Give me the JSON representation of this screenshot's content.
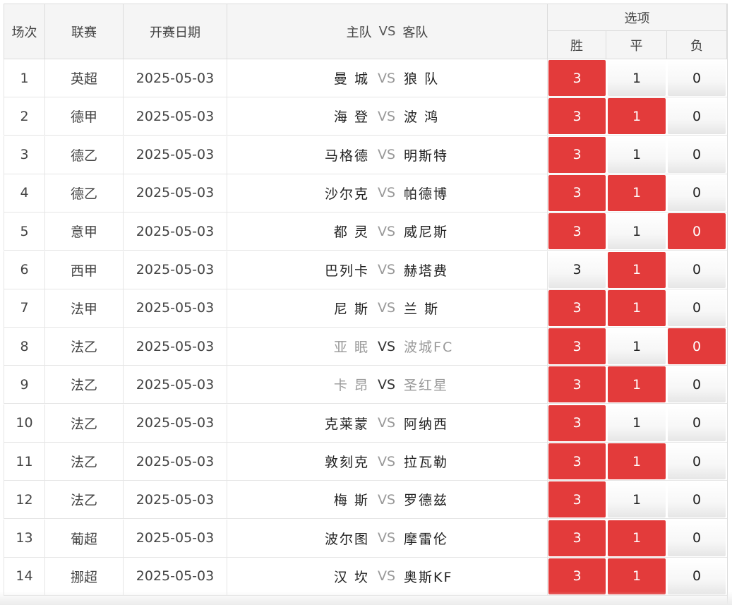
{
  "header": {
    "col_index": "场次",
    "col_league": "联赛",
    "col_date": "开赛日期",
    "col_home": "主队",
    "col_vs": "VS",
    "col_away": "客队",
    "col_options": "选项",
    "opt_win": "胜",
    "opt_draw": "平",
    "opt_loss": "负"
  },
  "colors": {
    "selected": "#e33b3b",
    "selected_text": "#ffffff",
    "vs_gray": "#999999"
  },
  "rows": [
    {
      "idx": "1",
      "league": "英超",
      "date": "2025-05-03",
      "home": "曼 城",
      "vs": "VS",
      "away": "狼 队",
      "win": "3",
      "draw": "1",
      "loss": "0",
      "sel": [
        true,
        false,
        false
      ],
      "dim": false
    },
    {
      "idx": "2",
      "league": "德甲",
      "date": "2025-05-03",
      "home": "海 登",
      "vs": "VS",
      "away": "波 鸿",
      "win": "3",
      "draw": "1",
      "loss": "0",
      "sel": [
        true,
        true,
        false
      ],
      "dim": false
    },
    {
      "idx": "3",
      "league": "德乙",
      "date": "2025-05-03",
      "home": "马格德",
      "vs": "VS",
      "away": "明斯特",
      "win": "3",
      "draw": "1",
      "loss": "0",
      "sel": [
        true,
        false,
        false
      ],
      "dim": false
    },
    {
      "idx": "4",
      "league": "德乙",
      "date": "2025-05-03",
      "home": "沙尔克",
      "vs": "VS",
      "away": "帕德博",
      "win": "3",
      "draw": "1",
      "loss": "0",
      "sel": [
        true,
        true,
        false
      ],
      "dim": false
    },
    {
      "idx": "5",
      "league": "意甲",
      "date": "2025-05-03",
      "home": "都 灵",
      "vs": "VS",
      "away": "威尼斯",
      "win": "3",
      "draw": "1",
      "loss": "0",
      "sel": [
        true,
        false,
        true
      ],
      "dim": false
    },
    {
      "idx": "6",
      "league": "西甲",
      "date": "2025-05-03",
      "home": "巴列卡",
      "vs": "VS",
      "away": "赫塔费",
      "win": "3",
      "draw": "1",
      "loss": "0",
      "sel": [
        false,
        true,
        false
      ],
      "dim": false
    },
    {
      "idx": "7",
      "league": "法甲",
      "date": "2025-05-03",
      "home": "尼 斯",
      "vs": "VS",
      "away": "兰 斯",
      "win": "3",
      "draw": "1",
      "loss": "0",
      "sel": [
        true,
        true,
        false
      ],
      "dim": false
    },
    {
      "idx": "8",
      "league": "法乙",
      "date": "2025-05-03",
      "home": "亚 眠",
      "vs": "VS",
      "away": "波城FC",
      "win": "3",
      "draw": "1",
      "loss": "0",
      "sel": [
        true,
        false,
        true
      ],
      "dim": true
    },
    {
      "idx": "9",
      "league": "法乙",
      "date": "2025-05-03",
      "home": "卡 昂",
      "vs": "VS",
      "away": "圣红星",
      "win": "3",
      "draw": "1",
      "loss": "0",
      "sel": [
        true,
        true,
        false
      ],
      "dim": true
    },
    {
      "idx": "10",
      "league": "法乙",
      "date": "2025-05-03",
      "home": "克莱蒙",
      "vs": "VS",
      "away": "阿纳西",
      "win": "3",
      "draw": "1",
      "loss": "0",
      "sel": [
        true,
        false,
        false
      ],
      "dim": false
    },
    {
      "idx": "11",
      "league": "法乙",
      "date": "2025-05-03",
      "home": "敦刻克",
      "vs": "VS",
      "away": "拉瓦勒",
      "win": "3",
      "draw": "1",
      "loss": "0",
      "sel": [
        true,
        true,
        false
      ],
      "dim": false
    },
    {
      "idx": "12",
      "league": "法乙",
      "date": "2025-05-03",
      "home": "梅 斯",
      "vs": "VS",
      "away": "罗德兹",
      "win": "3",
      "draw": "1",
      "loss": "0",
      "sel": [
        true,
        false,
        false
      ],
      "dim": false
    },
    {
      "idx": "13",
      "league": "葡超",
      "date": "2025-05-03",
      "home": "波尔图",
      "vs": "VS",
      "away": "摩雷伦",
      "win": "3",
      "draw": "1",
      "loss": "0",
      "sel": [
        true,
        true,
        false
      ],
      "dim": false
    },
    {
      "idx": "14",
      "league": "挪超",
      "date": "2025-05-03",
      "home": "汉 坎",
      "vs": "VS",
      "away": "奥斯KF",
      "win": "3",
      "draw": "1",
      "loss": "0",
      "sel": [
        true,
        true,
        false
      ],
      "dim": false
    }
  ]
}
